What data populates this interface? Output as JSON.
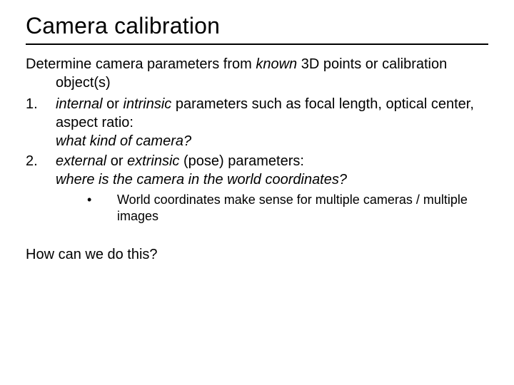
{
  "title": "Camera calibration",
  "intro": {
    "pre": "Determine camera parameters from ",
    "known": "known",
    "post": " 3D points or calibration object(s)"
  },
  "item1": {
    "num": "1.",
    "internal": "internal",
    "or": " or ",
    "intrinsic": "intrinsic",
    "rest1": " parameters such as focal length, optical center, aspect ratio:",
    "q": "what kind of camera?"
  },
  "item2": {
    "num": "2.",
    "external": "external",
    "or": " or ",
    "extrinsic": "extrinsic",
    "rest1": " (pose) parameters:",
    "q": "where is the camera in the world coordinates?"
  },
  "sub1": {
    "bullet": "•",
    "text": "World coordinates make sense for multiple cameras / multiple images"
  },
  "closing": "How can we do this?"
}
